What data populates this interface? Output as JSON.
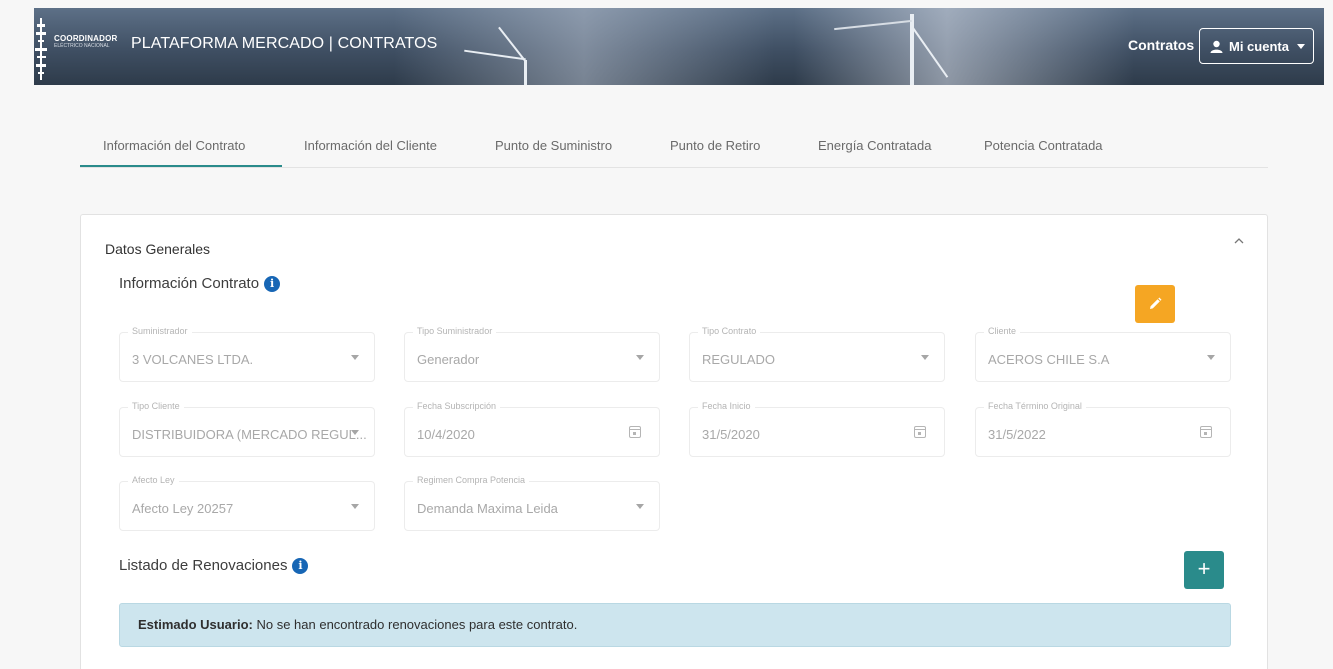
{
  "header": {
    "logo_text": "COORDINADOR",
    "logo_subtext": "ELÉCTRICO NACIONAL",
    "app_title": "PLATAFORMA MERCADO | CONTRATOS",
    "nav_link": "Contratos",
    "account_label": "Mi cuenta"
  },
  "tabs": [
    {
      "label": "Información del Contrato",
      "active": true
    },
    {
      "label": "Información del Cliente"
    },
    {
      "label": "Punto de Suministro"
    },
    {
      "label": "Punto de Retiro"
    },
    {
      "label": "Energía Contratada"
    },
    {
      "label": "Potencia Contratada"
    }
  ],
  "card": {
    "title": "Datos Generales",
    "info_section_title": "Información Contrato",
    "fields": [
      {
        "label": "Suministrador",
        "value": "3 VOLCANES LTDA.",
        "kind": "select"
      },
      {
        "label": "Tipo Suministrador",
        "value": "Generador",
        "kind": "select"
      },
      {
        "label": "Tipo Contrato",
        "value": "REGULADO",
        "kind": "select"
      },
      {
        "label": "Cliente",
        "value": "ACEROS CHILE S.A",
        "kind": "select"
      },
      {
        "label": "Tipo Cliente",
        "value": "DISTRIBUIDORA (MERCADO REGUL...",
        "kind": "select"
      },
      {
        "label": "Fecha Subscripción",
        "value": "10/4/2020",
        "kind": "date"
      },
      {
        "label": "Fecha Inicio",
        "value": "31/5/2020",
        "kind": "date"
      },
      {
        "label": "Fecha Término Original",
        "value": "31/5/2022",
        "kind": "date"
      },
      {
        "label": "Afecto Ley",
        "value": "Afecto Ley 20257",
        "kind": "select"
      },
      {
        "label": "Regimen Compra Potencia",
        "value": "Demanda Maxima Leida",
        "kind": "select"
      }
    ],
    "renewals_title": "Listado de Renovaciones",
    "add_button_label": "+",
    "alert_strong": "Estimado Usuario:",
    "alert_text": " No se han encontrado renovaciones para este contrato."
  },
  "colors": {
    "accent": "#2a8b8b",
    "edit": "#f5a623",
    "info": "#1766b5",
    "alert_bg": "#cde5ee"
  }
}
